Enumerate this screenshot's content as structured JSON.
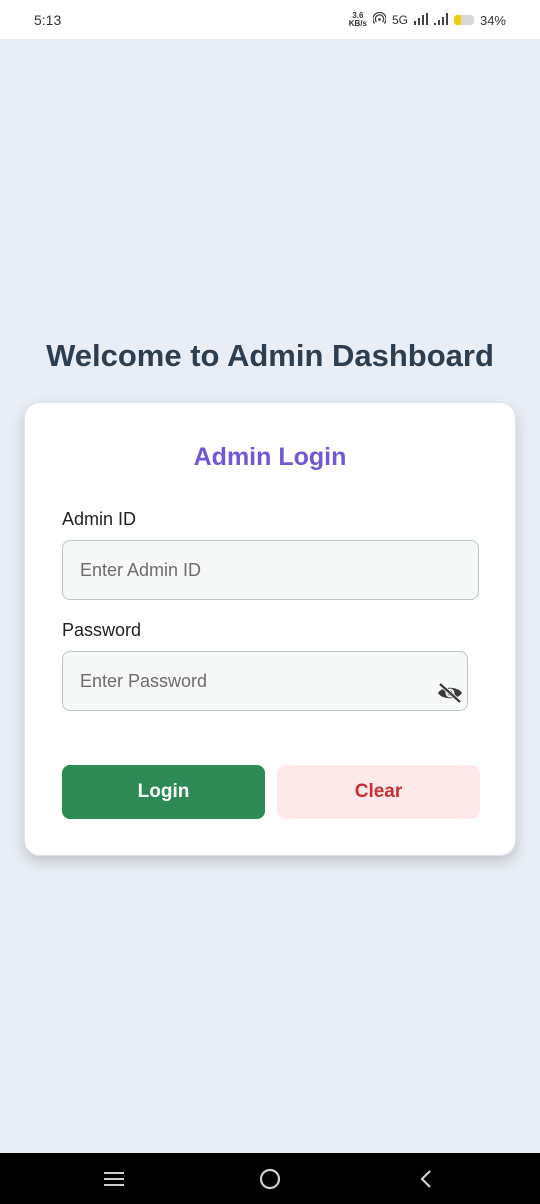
{
  "status_bar": {
    "time": "5:13",
    "net_speed_value": "3.6",
    "net_speed_unit": "KB/s",
    "network": "5G",
    "battery_percent": "34%",
    "battery_level": 0.34,
    "icons": [
      "hotspot-icon",
      "signal-icon",
      "signal-icon",
      "battery-icon"
    ]
  },
  "page": {
    "welcome_heading": "Welcome to Admin Dashboard"
  },
  "login_card": {
    "title": "Admin Login",
    "admin_id_label": "Admin ID",
    "admin_id_placeholder": "Enter Admin ID",
    "admin_id_value": "",
    "password_label": "Password",
    "password_placeholder": "Enter Password",
    "password_value": "",
    "toggle_visibility_icon": "eye-off-icon",
    "login_button": "Login",
    "clear_button": "Clear"
  },
  "navigation": {
    "icons": [
      "menu-icon",
      "home-icon",
      "back-icon"
    ]
  },
  "colors": {
    "background": "#e9eef6",
    "heading": "#2d3e50",
    "card_title": "#7357d6",
    "login_button": "#2e8a55",
    "clear_button_bg": "#fde9ea",
    "clear_button_text": "#c73232"
  }
}
